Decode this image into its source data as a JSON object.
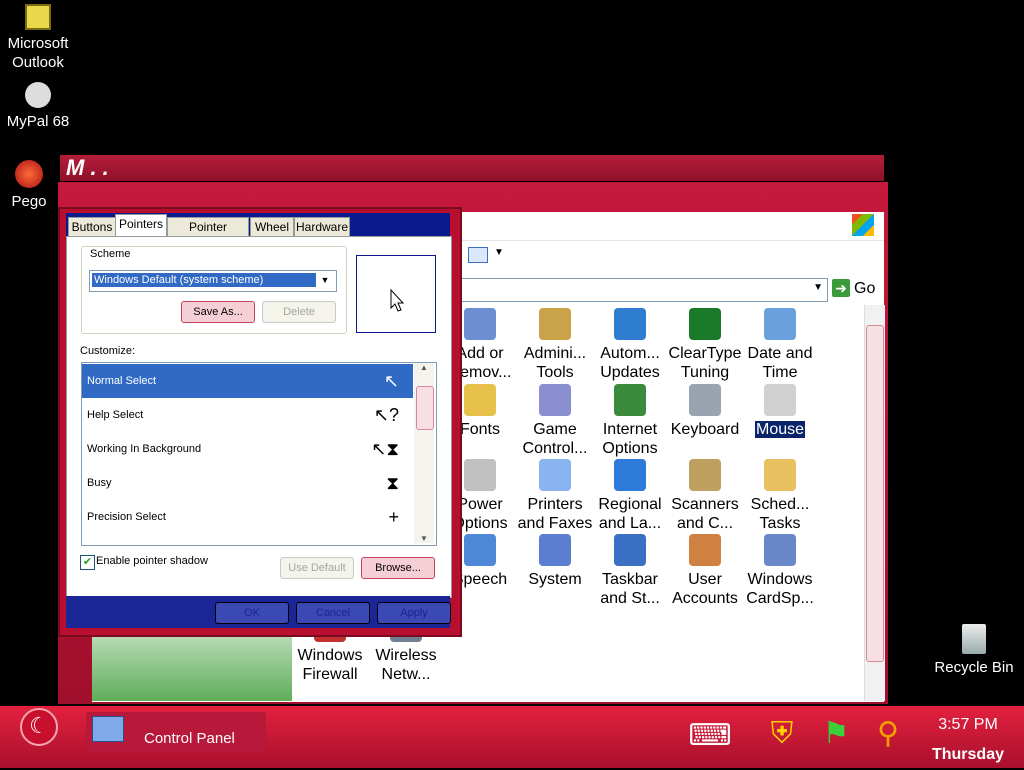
{
  "desktop": {
    "icons": [
      {
        "label": "Microsoft Outlook"
      },
      {
        "label": "MyPal 68"
      },
      {
        "label": "Pego"
      },
      {
        "label": "Recycle Bin"
      }
    ]
  },
  "back_window": {
    "title_fragment": "M . .",
    "go_label": "Go"
  },
  "control_panel": {
    "items": [
      {
        "label": "Add or Remov...",
        "icon": "add-remove-icon"
      },
      {
        "label": "Admini... Tools",
        "icon": "admin-tools-icon"
      },
      {
        "label": "Autom... Updates",
        "icon": "updates-icon"
      },
      {
        "label": "ClearType Tuning",
        "icon": "cleartype-icon"
      },
      {
        "label": "Date and Time",
        "icon": "clock-icon"
      },
      {
        "label": "Fonts",
        "icon": "fonts-folder-icon"
      },
      {
        "label": "Game Control...",
        "icon": "gamepad-icon"
      },
      {
        "label": "Internet Options",
        "icon": "globe-icon"
      },
      {
        "label": "Keyboard",
        "icon": "keyboard-icon"
      },
      {
        "label": "Mouse",
        "icon": "mouse-icon",
        "selected": true
      },
      {
        "label": "Power Options",
        "icon": "power-icon"
      },
      {
        "label": "Printers and Faxes",
        "icon": "printer-icon"
      },
      {
        "label": "Regional and La...",
        "icon": "regional-globe-icon"
      },
      {
        "label": "Scanners and C...",
        "icon": "scanner-icon"
      },
      {
        "label": "Sched... Tasks",
        "icon": "scheduled-tasks-icon"
      },
      {
        "label": "Speech",
        "icon": "speech-icon"
      },
      {
        "label": "System",
        "icon": "system-icon"
      },
      {
        "label": "Taskbar and St...",
        "icon": "taskbar-icon"
      },
      {
        "label": "User Accounts",
        "icon": "users-icon"
      },
      {
        "label": "Windows CardSp...",
        "icon": "cardspace-icon"
      },
      {
        "label": "Windows Firewall",
        "icon": "firewall-icon"
      },
      {
        "label": "Wireless Netw...",
        "icon": "wireless-icon"
      }
    ]
  },
  "dialog": {
    "tabs": [
      "Buttons",
      "Pointers",
      "Pointer Options",
      "Wheel",
      "Hardware"
    ],
    "active_tab": "Pointers",
    "scheme_label": "Scheme",
    "scheme_value": "Windows Default (system scheme)",
    "save_as_label": "Save As...",
    "delete_label": "Delete",
    "customize_label": "Customize:",
    "cursors": [
      {
        "label": "Normal Select",
        "glyph": "arrow-cursor-icon"
      },
      {
        "label": "Help Select",
        "glyph": "help-cursor-icon"
      },
      {
        "label": "Working In Background",
        "glyph": "working-cursor-icon"
      },
      {
        "label": "Busy",
        "glyph": "hourglass-icon"
      },
      {
        "label": "Precision Select",
        "glyph": "crosshair-icon"
      }
    ],
    "shadow_label": "Enable pointer shadow",
    "shadow_checked": true,
    "use_default_label": "Use Default",
    "browse_label": "Browse...",
    "ok_label": "OK",
    "cancel_label": "Cancel",
    "apply_label": "Apply"
  },
  "taskbar": {
    "task_label": "Control Panel",
    "time": "3:57 PM",
    "day": "Thursday"
  }
}
